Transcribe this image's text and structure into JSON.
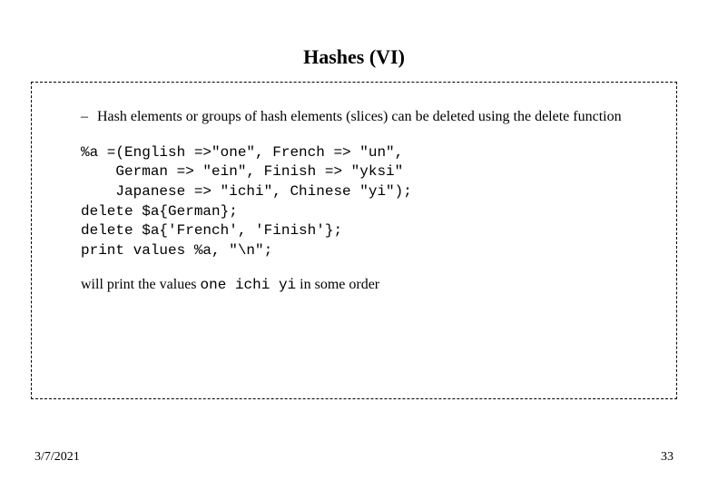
{
  "title": "Hashes (VI)",
  "bullet": {
    "dash": "–",
    "text": "Hash elements or groups of hash elements (slices) can be deleted using the delete function"
  },
  "code": "%a =(English =>\"one\", French => \"un\",\n    German => \"ein\", Finish => \"yksi\"\n    Japanese => \"ichi\", Chinese \"yi\");\ndelete $a{German};\ndelete $a{'French', 'Finish'};\nprint values %a, \"\\n\";",
  "closing": {
    "prefix": "will print the values ",
    "mono": "one ichi yi",
    "suffix": " in some order"
  },
  "footer": {
    "date": "3/7/2021",
    "page": "33"
  }
}
